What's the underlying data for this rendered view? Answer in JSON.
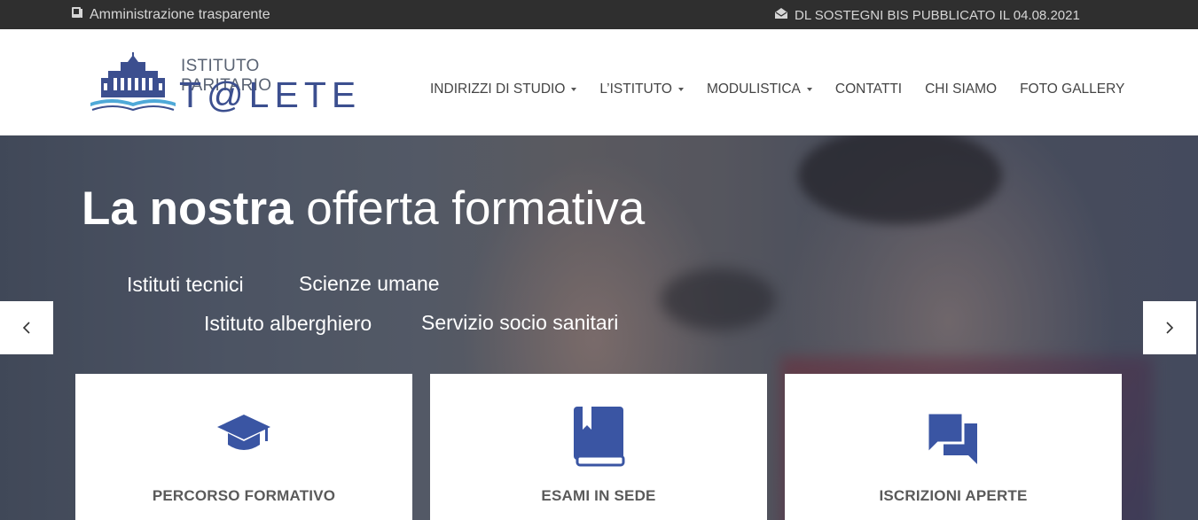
{
  "topbar": {
    "left_icon": "book-icon",
    "left_text": "Amministrazione trasparente",
    "right_icon": "envelope-open-icon",
    "right_text": "DL SOSTEGNI BIS PUBBLICATO IL 04.08.2021"
  },
  "logo": {
    "line1": "ISTITUTO PARITARIO",
    "line2": "T@LETE",
    "brand_color": "#3c4f8f"
  },
  "nav": {
    "items": [
      {
        "label": "INDIRIZZI DI STUDIO",
        "dropdown": true
      },
      {
        "label": "L’ISTITUTO",
        "dropdown": true
      },
      {
        "label": "MODULISTICA",
        "dropdown": true
      },
      {
        "label": "CONTATTI",
        "dropdown": false
      },
      {
        "label": "CHI SIAMO",
        "dropdown": false
      },
      {
        "label": "FOTO GALLERY",
        "dropdown": false
      }
    ]
  },
  "hero": {
    "title_bold": "La nostra",
    "title_light": "offerta formativa",
    "tags": [
      "Istituti tecnici",
      "Scienze umane",
      "Istituto alberghiero",
      "Servizio socio sanitari"
    ],
    "prev_icon": "chevron-left-icon",
    "next_icon": "chevron-right-icon"
  },
  "cards": [
    {
      "icon": "graduation-cap-icon",
      "label": "PERCORSO FORMATIVO"
    },
    {
      "icon": "book-icon",
      "label": "ESAMI IN SEDE"
    },
    {
      "icon": "chat-bubbles-icon",
      "label": "ISCRIZIONI APERTE"
    }
  ],
  "colors": {
    "accent": "#3a55a3",
    "topbar_bg": "#2f2f2f"
  }
}
